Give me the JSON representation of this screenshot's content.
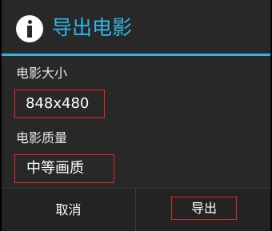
{
  "dialog": {
    "title": "导出电影",
    "icon": "info-icon",
    "accent_color": "#33b5e5",
    "highlight_color": "#e02a2a"
  },
  "fields": {
    "size": {
      "label": "电影大小",
      "value": "848x480"
    },
    "quality": {
      "label": "电影质量",
      "value": "中等画质"
    }
  },
  "buttons": {
    "cancel_label": "取消",
    "export_label": "导出"
  }
}
